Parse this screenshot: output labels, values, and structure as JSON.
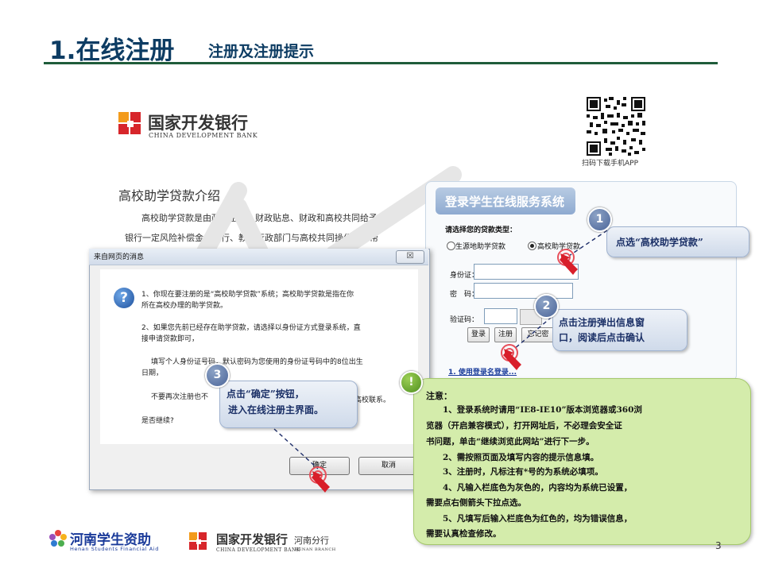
{
  "header": {
    "title": "1.在线注册",
    "subtitle": "注册及注册提示"
  },
  "bank": {
    "name": "国家开发银行",
    "english": "CHINA DEVELOPMENT BANK",
    "colors": {
      "red": "#d7262b",
      "orange": "#f39b1c",
      "gray": "#555555"
    }
  },
  "qr": {
    "caption": "扫码下载手机APP"
  },
  "intro": {
    "title": "高校助学贷款介绍",
    "line1": "高校助学贷款是由政府主导、财政贴息、财政和高校共同给予",
    "line2": "银行一定风险补偿金，银行、教育行政部门与高校共同操作的，帮"
  },
  "login": {
    "title": "登录学生在线服务系统",
    "loan_type_label": "请选择您的贷款类型：",
    "option_local": "生源地助学贷款",
    "option_campus": "高校助学贷款",
    "id_label": "身份证：",
    "password_label": "密　码：",
    "captcha_label": "验证码：",
    "login_button": "登录",
    "register_button": "注册",
    "forgot_button": "忘记密",
    "link": "1. 使用登录名登录..."
  },
  "dialog": {
    "title": "来自网页的消息",
    "close": "☒",
    "p1a": "1、你现在要注册的是“高校助学贷款”系统；高校助学贷款是指在你",
    "p1b": "所在高校办理的助学贷款。",
    "p2a": "2、如果您先前已经存在助学贷款，请选择以身份证方式登录系统，直",
    "p2b": "接申请贷款即可，",
    "p3a": "填写个人身份证号码，默认密码为您使用的身份证号码中的8位出生",
    "p3b": "日期，",
    "p4a": "不要再次注册也不",
    "p4b": "高校联系。",
    "question": "是否继续?",
    "ok": "确定",
    "cancel": "取消"
  },
  "callouts": {
    "c1_num": "1",
    "c1_text": "点选“高校助学贷款”",
    "c2_num": "2",
    "c2_line1": "点击注册弹出信息窗",
    "c2_line2": "口，阅读后点击确认",
    "c3_num": "3",
    "c3_line1": "点击“确定”按钮，",
    "c3_line2": "进入在线注册主界面。"
  },
  "note": {
    "badge": "!",
    "title": "注意：",
    "lines": [
      "　　1、登录系统时请用“IE8-IE10”版本浏览器或360浏",
      "览器（开启兼容模式），打开网址后，不必理会安全证",
      "书问题，单击“继续浏览此网站”进行下一步。",
      "　　2、需按照页面及填写内容的提示信息填。",
      "　　3、注册时，凡标注有*号的为系统必填项。",
      "　　4、凡输入栏底色为灰色的，内容均为系统已设置，",
      "需要点右侧箭头下拉点选。",
      "　　5、凡填写后输入栏底色为红色的，均为错误信息，",
      "需要认真检查修改。"
    ]
  },
  "footer": {
    "henan_name": "河南学生资助",
    "henan_english": "Henan Students Financial Aid",
    "bank_name": "国家开发银行",
    "bank_branch": "河南分行",
    "bank_english": "CHINA DEVELOPMENT BANK",
    "bank_branch_english": "HENAN BRANCH",
    "page": "3"
  },
  "accent": {
    "title_blue": "#0d3c63",
    "note_green": "#d4ecab",
    "callout_blue": "#1a2f66"
  }
}
